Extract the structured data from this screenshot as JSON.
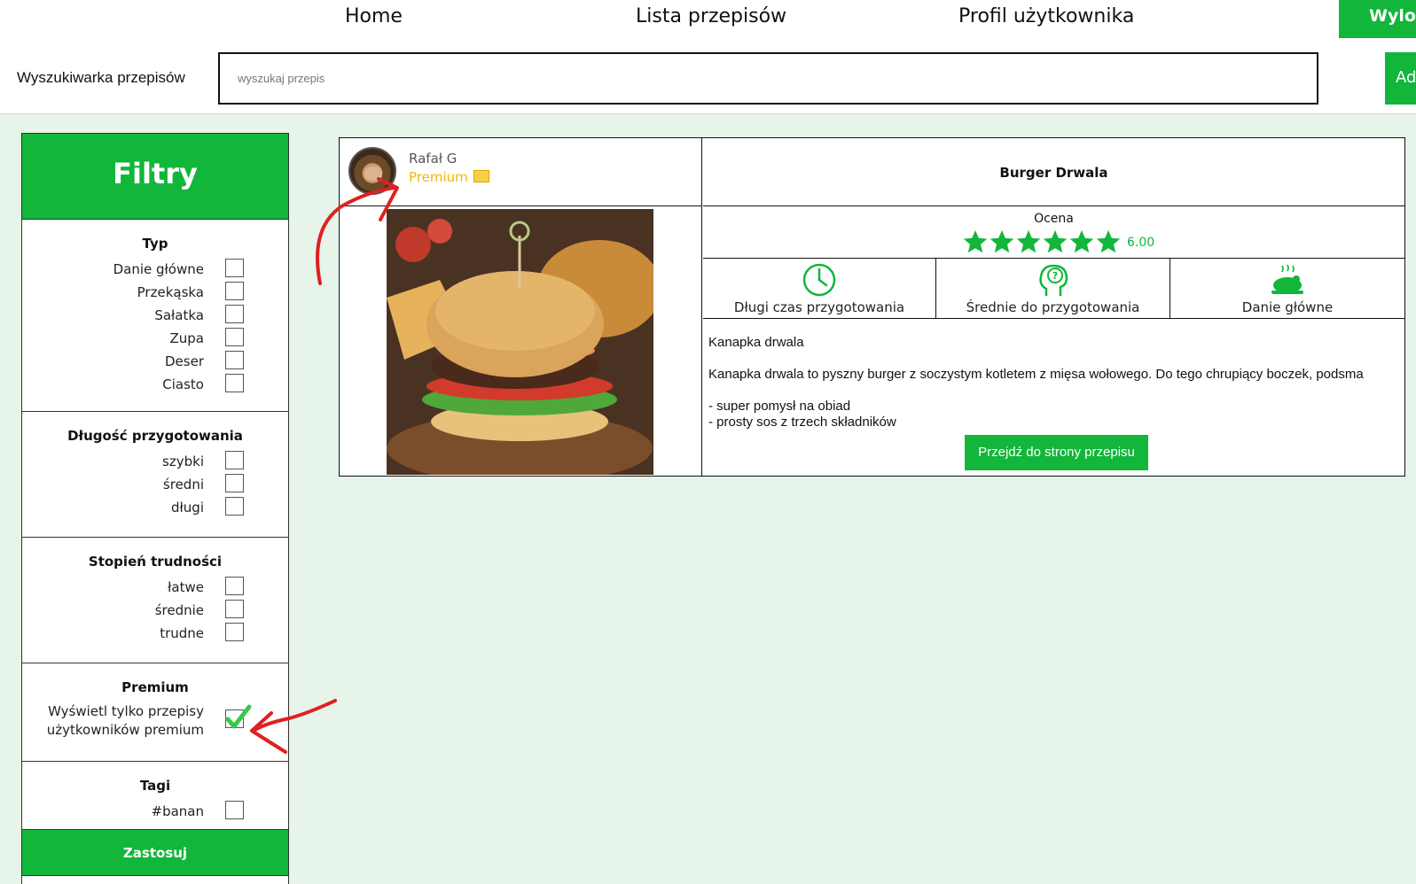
{
  "nav": {
    "home": "Home",
    "recipes": "Lista przepisów",
    "profile": "Profil użytkownika",
    "logout": "Wylog"
  },
  "search": {
    "label": "Wyszukiwarka przepisów",
    "placeholder": "wyszukaj przepis",
    "add_button": "Ad"
  },
  "filters": {
    "title": "Filtry",
    "type": {
      "title": "Typ",
      "options": [
        "Danie główne",
        "Przekąska",
        "Sałatka",
        "Zupa",
        "Deser",
        "Ciasto"
      ]
    },
    "duration": {
      "title": "Długość przygotowania",
      "options": [
        "szybki",
        "średni",
        "długi"
      ]
    },
    "difficulty": {
      "title": "Stopień trudności",
      "options": [
        "łatwe",
        "średnie",
        "trudne"
      ]
    },
    "premium": {
      "title": "Premium",
      "option": "Wyświetl tylko przepisy użytkowników premium",
      "checked": true
    },
    "tags": {
      "title": "Tagi",
      "options": [
        "#banan"
      ]
    },
    "apply": "Zastosuj"
  },
  "recipe": {
    "author": "Rafał G",
    "author_badge": "Premium",
    "title": "Burger Drwala",
    "rating_label": "Ocena",
    "rating_value": "6.00",
    "stars": 6,
    "time": "Długi czas przygotowania",
    "difficulty": "Średnie do przygotowania",
    "category": "Danie główne",
    "description_title": "Kanapka drwala",
    "description": "Kanapka drwala to pyszny burger z soczystym kotletem z mięsa wołowego. Do tego chrupiący boczek, podsma",
    "bullets": [
      "- super pomysł na obiad",
      "- prosty sos z trzech składników"
    ],
    "go_button": "Przejdź do strony przepisu"
  },
  "colors": {
    "accent": "#11b63a",
    "background": "#e6f4ea",
    "premium": "#f2b705",
    "annotation": "#e02020"
  }
}
